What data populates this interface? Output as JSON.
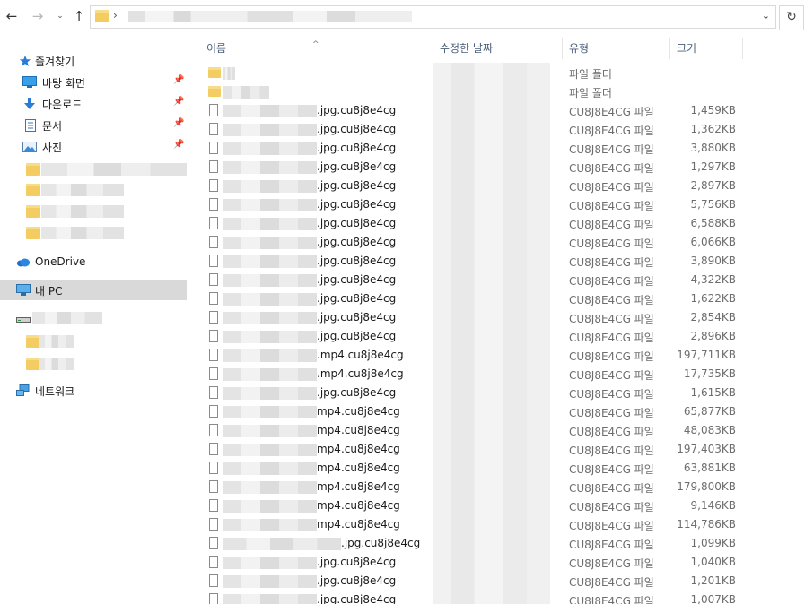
{
  "nav": {
    "back_icon": "arrow-left-icon",
    "forward_icon": "arrow-right-icon",
    "recent_icon": "chevron-down-icon",
    "up_icon": "arrow-up-icon",
    "back_glyph": "←",
    "forward_glyph": "→",
    "recent_glyph": "⌄",
    "up_glyph": "↑",
    "path_sep": "›",
    "dropdown_glyph": "⌄",
    "refresh_glyph": "↻"
  },
  "sidebar": {
    "quick_access": "즐겨찾기",
    "items": [
      {
        "label": "바탕 화면",
        "icon": "desktop-icon",
        "pinned": true
      },
      {
        "label": "다운로드",
        "icon": "download-icon",
        "pinned": true
      },
      {
        "label": "문서",
        "icon": "document-icon",
        "pinned": true
      },
      {
        "label": "사진",
        "icon": "pictures-icon",
        "pinned": true
      }
    ],
    "pin_glyph": "📌",
    "onedrive": "OneDrive",
    "this_pc": "내 PC",
    "network": "네트워크"
  },
  "columns": {
    "name": "이름",
    "modified": "수정한 날짜",
    "type": "유형",
    "size": "크기",
    "sort_glyph": "^"
  },
  "files": [
    {
      "kind": "folder",
      "ext": "",
      "type": "파일 폴더",
      "size": ""
    },
    {
      "kind": "folder",
      "ext": "",
      "type": "파일 폴더",
      "size": ""
    },
    {
      "kind": "file",
      "ext": ".jpg.cu8j8e4cg",
      "type": "CU8J8E4CG 파일",
      "size": "1,459KB"
    },
    {
      "kind": "file",
      "ext": ".jpg.cu8j8e4cg",
      "type": "CU8J8E4CG 파일",
      "size": "1,362KB"
    },
    {
      "kind": "file",
      "ext": ".jpg.cu8j8e4cg",
      "type": "CU8J8E4CG 파일",
      "size": "3,880KB"
    },
    {
      "kind": "file",
      "ext": ".jpg.cu8j8e4cg",
      "type": "CU8J8E4CG 파일",
      "size": "1,297KB"
    },
    {
      "kind": "file",
      "ext": ".jpg.cu8j8e4cg",
      "type": "CU8J8E4CG 파일",
      "size": "2,897KB"
    },
    {
      "kind": "file",
      "ext": ".jpg.cu8j8e4cg",
      "type": "CU8J8E4CG 파일",
      "size": "5,756KB"
    },
    {
      "kind": "file",
      "ext": ".jpg.cu8j8e4cg",
      "type": "CU8J8E4CG 파일",
      "size": "6,588KB"
    },
    {
      "kind": "file",
      "ext": ".jpg.cu8j8e4cg",
      "type": "CU8J8E4CG 파일",
      "size": "6,066KB"
    },
    {
      "kind": "file",
      "ext": ".jpg.cu8j8e4cg",
      "type": "CU8J8E4CG 파일",
      "size": "3,890KB"
    },
    {
      "kind": "file",
      "ext": ".jpg.cu8j8e4cg",
      "type": "CU8J8E4CG 파일",
      "size": "4,322KB"
    },
    {
      "kind": "file",
      "ext": ".jpg.cu8j8e4cg",
      "type": "CU8J8E4CG 파일",
      "size": "1,622KB"
    },
    {
      "kind": "file",
      "ext": ".jpg.cu8j8e4cg",
      "type": "CU8J8E4CG 파일",
      "size": "2,854KB"
    },
    {
      "kind": "file",
      "ext": ".jpg.cu8j8e4cg",
      "type": "CU8J8E4CG 파일",
      "size": "2,896KB"
    },
    {
      "kind": "file",
      "ext": ".mp4.cu8j8e4cg",
      "type": "CU8J8E4CG 파일",
      "size": "197,711KB"
    },
    {
      "kind": "file",
      "ext": ".mp4.cu8j8e4cg",
      "type": "CU8J8E4CG 파일",
      "size": "17,735KB"
    },
    {
      "kind": "file",
      "ext": ".jpg.cu8j8e4cg",
      "type": "CU8J8E4CG 파일",
      "size": "1,615KB"
    },
    {
      "kind": "file",
      "ext": "mp4.cu8j8e4cg",
      "type": "CU8J8E4CG 파일",
      "size": "65,877KB"
    },
    {
      "kind": "file",
      "ext": "mp4.cu8j8e4cg",
      "type": "CU8J8E4CG 파일",
      "size": "48,083KB"
    },
    {
      "kind": "file",
      "ext": "mp4.cu8j8e4cg",
      "type": "CU8J8E4CG 파일",
      "size": "197,403KB"
    },
    {
      "kind": "file",
      "ext": "mp4.cu8j8e4cg",
      "type": "CU8J8E4CG 파일",
      "size": "63,881KB"
    },
    {
      "kind": "file",
      "ext": "mp4.cu8j8e4cg",
      "type": "CU8J8E4CG 파일",
      "size": "179,800KB"
    },
    {
      "kind": "file",
      "ext": "mp4.cu8j8e4cg",
      "type": "CU8J8E4CG 파일",
      "size": "9,146KB"
    },
    {
      "kind": "file",
      "ext": "mp4.cu8j8e4cg",
      "type": "CU8J8E4CG 파일",
      "size": "114,786KB"
    },
    {
      "kind": "file",
      "ext": ".jpg.cu8j8e4cg",
      "type": "CU8J8E4CG 파일",
      "size": "1,099KB"
    },
    {
      "kind": "file",
      "ext": ".jpg.cu8j8e4cg",
      "type": "CU8J8E4CG 파일",
      "size": "1,040KB"
    },
    {
      "kind": "file",
      "ext": ".jpg.cu8j8e4cg",
      "type": "CU8J8E4CG 파일",
      "size": "1,201KB"
    },
    {
      "kind": "file",
      "ext": ".jpg.cu8j8e4cg",
      "type": "CU8J8E4CG 파일",
      "size": "1,007KB"
    }
  ],
  "colors": {
    "folder": "#f3cd62",
    "header_text": "#4c607a",
    "selected_bg": "#d9d9d9",
    "accent_blue": "#1e88e5"
  }
}
